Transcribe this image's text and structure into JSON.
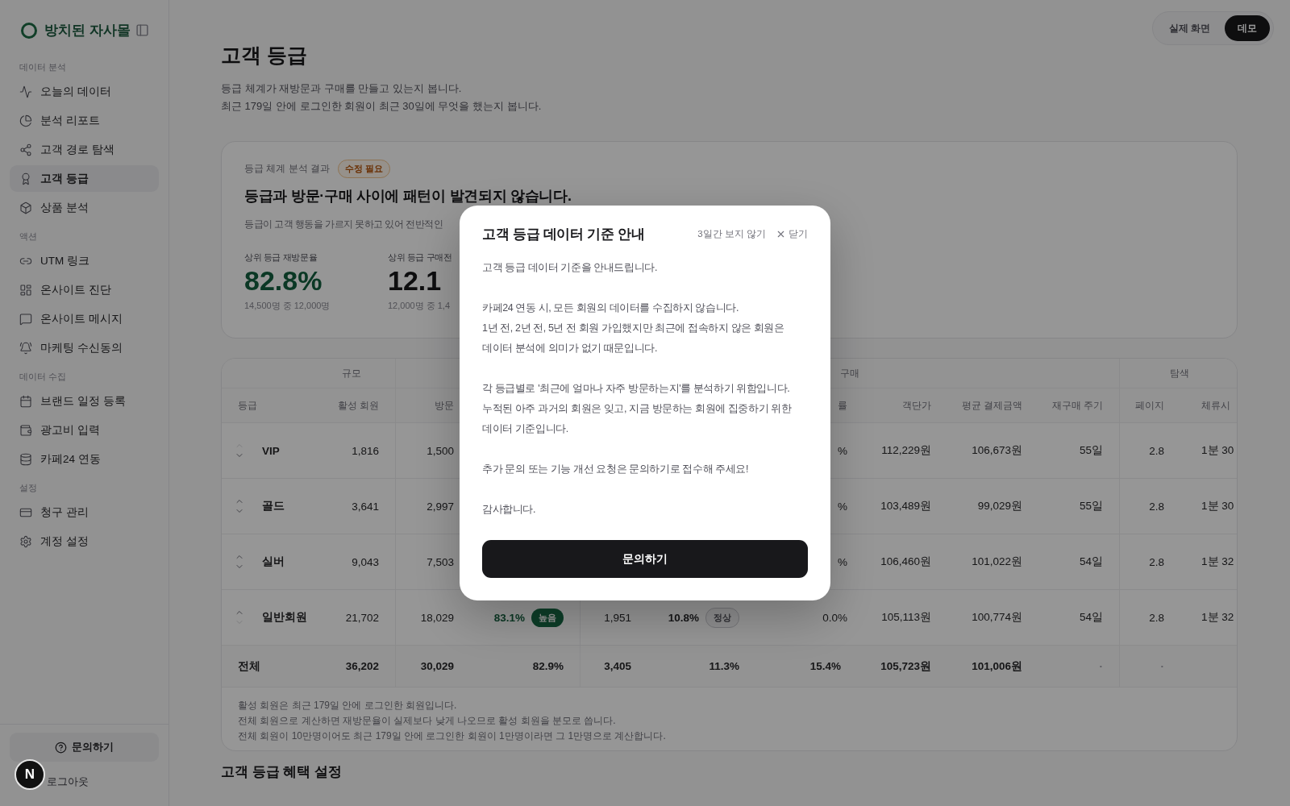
{
  "sidebar": {
    "brand": "방치된 자사몰",
    "sections": [
      {
        "title": "데이터 분석",
        "items": [
          {
            "label": "오늘의 데이터",
            "selected": false
          },
          {
            "label": "분석 리포트",
            "selected": false
          },
          {
            "label": "고객 경로 탐색",
            "selected": false
          },
          {
            "label": "고객 등급",
            "selected": true
          },
          {
            "label": "상품 분석",
            "selected": false
          }
        ]
      },
      {
        "title": "액션",
        "items": [
          {
            "label": "UTM 링크",
            "selected": false
          },
          {
            "label": "온사이트 진단",
            "selected": false
          },
          {
            "label": "온사이트 메시지",
            "selected": false
          },
          {
            "label": "마케팅 수신동의",
            "selected": false
          }
        ]
      },
      {
        "title": "데이터 수집",
        "items": [
          {
            "label": "브랜드 일정 등록",
            "selected": false
          },
          {
            "label": "광고비 입력",
            "selected": false
          },
          {
            "label": "카페24 연동",
            "selected": false
          }
        ]
      },
      {
        "title": "설정",
        "items": [
          {
            "label": "청구 관리",
            "selected": false
          },
          {
            "label": "계정 설정",
            "selected": false
          }
        ]
      }
    ],
    "help_button": "문의하기",
    "logout": "로그아웃"
  },
  "view_toggle": [
    {
      "label": "실제 화면",
      "selected": false
    },
    {
      "label": "데모",
      "selected": true
    }
  ],
  "page": {
    "title": "고객 등급",
    "subtitle_lines": [
      "등급 체계가 재방문과 구매를 만들고 있는지 봅니다.",
      "최근 179일 안에 로그인한 회원이 최근 30일에 무엇을 했는지 봅니다."
    ]
  },
  "analysis_card": {
    "label": "등급 체계 분석 결과",
    "badge": "수정 필요",
    "headline": "등급과 방문·구매 사이에 패턴이 발견되지 않습니다.",
    "description": "등급이 고객 행동을 가르지 못하고 있어 전반적인",
    "metrics": [
      {
        "label": "상위 등급 재방문율",
        "value": "82.8%",
        "highlighted": true,
        "detail": "14,500명 중 12,000명"
      },
      {
        "label": "상위 등급 구매전",
        "value": "12.1",
        "highlighted": false,
        "detail": "12,000명 중 1,4"
      }
    ]
  },
  "grade_table": {
    "groups": [
      "규모",
      "구매",
      "탐색"
    ],
    "grade_column": "등급",
    "columns": [
      "활성 회원",
      "방문",
      null,
      null,
      null,
      "률",
      "객단가",
      "평균 결제금액",
      "재구매 주기",
      "페이지",
      "체류시"
    ],
    "rows": [
      {
        "grade": "VIP",
        "cells": [
          "1,816",
          "1,500",
          null,
          null,
          null,
          "%",
          "112,229원",
          "106,673원",
          "55일",
          "2.8",
          "1분 30"
        ]
      },
      {
        "grade": "골드",
        "cells": [
          "3,641",
          "2,997",
          null,
          null,
          null,
          "%",
          "103,489원",
          "99,029원",
          "55일",
          "2.8",
          "1분 30"
        ]
      },
      {
        "grade": "실버",
        "cells": [
          "9,043",
          "7,503",
          null,
          null,
          null,
          "%",
          "106,460원",
          "101,022원",
          "54일",
          "2.8",
          "1분 32"
        ]
      },
      {
        "grade": "일반회원",
        "cells": [
          "21,702",
          "18,029",
          {
            "text": "83.1%",
            "badge": "높음",
            "highlighted": true
          },
          "1,951",
          {
            "text": "10.8%",
            "badge": "정상",
            "highlighted": false
          },
          "0.0%",
          "105,113원",
          "100,774원",
          "54일",
          "2.8",
          "1분 32"
        ]
      }
    ],
    "total": {
      "label": "전체",
      "cells": [
        "36,202",
        "30,029",
        "82.9%",
        "3,405",
        "11.3%",
        "15.4%",
        "105,723원",
        "101,006원",
        "·",
        "·"
      ]
    },
    "notes": [
      "활성 회원은 최근 179일 안에 로그인한 회원입니다.",
      "전체 회원으로 계산하면 재방문율이 실제보다 낮게 나오므로 활성 회원을 분모로 씁니다.",
      "전체 회원이 10만명이어도 최근 179일 안에 로그인한 회원이 1만명이라면 그 1만명으로 계산합니다."
    ]
  },
  "next_section": {
    "title": "고객 등급 혜택 설정"
  },
  "modal": {
    "title": "고객 등급 데이터 기준 안내",
    "hide_link": "3일간 보지 않기",
    "close": "닫기",
    "paragraphs": [
      "고객 등급 데이터 기준을 안내드립니다.",
      "카페24 연동 시, 모든 회원의 데이터를 수집하지 않습니다.\n1년 전, 2년 전, 5년 전 회원 가입했지만 최근에 접속하지 않은 회원은\n데이터 분석에 의미가 없기 때문입니다.",
      "각 등급별로 '최근에 얼마나 자주 방문하는지'를 분석하기 위함입니다.\n누적된 아주 과거의 회원은 잊고, 지금 방문하는 회원에 집중하기 위한\n데이터 기준입니다.",
      "추가 문의 또는 기능 개선 요청은 문의하기로 접수해 주세요!",
      "감사합니다."
    ],
    "button": "문의하기"
  },
  "dev_badge": "N"
}
